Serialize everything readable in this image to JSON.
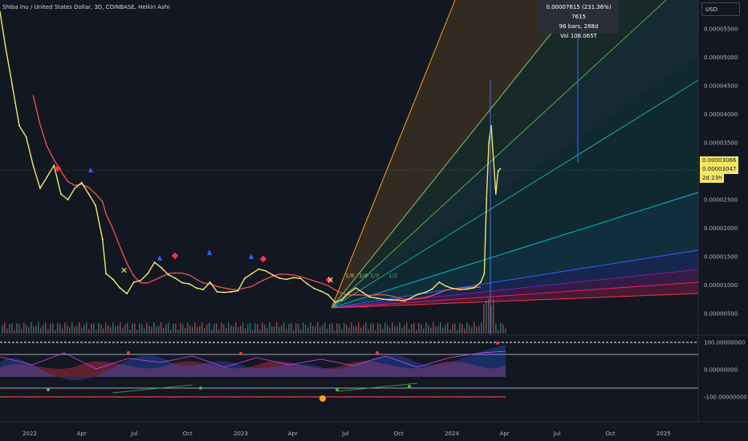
{
  "header": {
    "title": "Shiba Inu / United States Dollar, 3D, COINBASE, Heikin Ashi",
    "currency": "USD"
  },
  "measure_tooltip": {
    "line1": "0.00007615 (231.36%) 7615",
    "line2": "96 bars, 288d",
    "line3": "Vol 108.065T"
  },
  "price_tags": {
    "last": "0.00003066",
    "close": "0.00003047",
    "countdown": "2d 23h"
  },
  "fib_labels": [
    "1/8",
    "1/4",
    "1/3",
    "1/2"
  ],
  "colors": {
    "background": "#131722",
    "price_line": "#f5e663",
    "ma_line": "#f05454",
    "up_marker": "#2962ff",
    "down_marker": "#f23645"
  },
  "oscillator_axis": {
    "ticks": [
      {
        "label": "100.00000000",
        "value": 100
      },
      {
        "label": "0.00000000",
        "value": 0
      },
      {
        "label": "-100.00000000",
        "value": -100
      }
    ]
  },
  "chart_data": {
    "type": "line",
    "title": "Shiba Inu / United States Dollar, 3D, COINBASE, Heikin Ashi",
    "xlabel": "",
    "ylabel": "",
    "x_ticks": [
      "2022",
      "Apr",
      "Jul",
      "Oct",
      "2023",
      "Apr",
      "Jul",
      "Oct",
      "2024",
      "Apr",
      "Jul",
      "Oct",
      "2025"
    ],
    "y_ticks": [
      "0.00005500",
      "0.00005000",
      "0.00004500",
      "0.00004000",
      "0.00003500",
      "0.00003000",
      "0.00002500",
      "0.00002000",
      "0.00001500",
      "0.00001000",
      "0.00000500"
    ],
    "ylim": [
      3.5e-06,
      5.9e-05
    ],
    "grid": false,
    "series": [
      {
        "x": [
          "2021-11-08",
          "2021-11-20",
          "2021-12-02",
          "2021-12-14",
          "2021-12-26",
          "2022-01-07",
          "2022-01-19",
          "2022-01-31",
          "2022-02-12",
          "2022-02-24",
          "2022-03-08",
          "2022-03-20",
          "2022-04-01",
          "2022-04-13",
          "2022-04-25",
          "2022-05-07",
          "2022-05-13",
          "2022-05-25",
          "2022-06-06",
          "2022-06-18",
          "2022-06-30",
          "2022-07-12",
          "2022-07-24",
          "2022-08-05",
          "2022-08-17",
          "2022-08-29",
          "2022-09-10",
          "2022-09-22",
          "2022-10-04",
          "2022-10-16",
          "2022-10-28",
          "2022-11-09",
          "2022-11-21",
          "2022-12-03",
          "2022-12-15",
          "2022-12-27",
          "2023-01-08",
          "2023-01-20",
          "2023-02-01",
          "2023-02-13",
          "2023-02-25",
          "2023-03-09",
          "2023-03-21",
          "2023-04-02",
          "2023-04-14",
          "2023-04-26",
          "2023-05-08",
          "2023-05-20",
          "2023-06-01",
          "2023-06-13",
          "2023-06-25",
          "2023-07-07",
          "2023-07-19",
          "2023-07-31",
          "2023-08-12",
          "2023-08-24",
          "2023-09-05",
          "2023-09-17",
          "2023-09-29",
          "2023-10-11",
          "2023-10-23",
          "2023-11-04",
          "2023-11-16",
          "2023-11-28",
          "2023-12-10",
          "2023-12-22",
          "2024-01-03",
          "2024-01-15",
          "2024-01-27",
          "2024-02-08",
          "2024-02-20",
          "2024-02-26",
          "2024-03-01",
          "2024-03-05",
          "2024-03-09",
          "2024-03-13",
          "2024-03-17",
          "2024-03-21",
          "2024-03-25"
        ],
        "values": [
          5.8e-05,
          5.2e-05,
          4.5e-05,
          3.8e-05,
          3.6e-05,
          3.1e-05,
          2.7e-05,
          2.9e-05,
          3.1e-05,
          2.6e-05,
          2.5e-05,
          2.7e-05,
          2.8e-05,
          2.6e-05,
          2.4e-05,
          1.8e-05,
          1.2e-05,
          1.1e-05,
          9.5e-06,
          8.5e-06,
          1.05e-05,
          1.08e-05,
          1.2e-05,
          1.4e-05,
          1.3e-05,
          1.18e-05,
          1.12e-05,
          1.04e-05,
          1.02e-05,
          9.5e-06,
          9.2e-06,
          1.05e-05,
          8.8e-06,
          8.7e-06,
          8.8e-06,
          9e-06,
          1.12e-05,
          1.2e-05,
          1.28e-05,
          1.25e-05,
          1.18e-05,
          1.12e-05,
          1.1e-05,
          1.13e-05,
          1.12e-05,
          1.02e-05,
          9.4e-06,
          8.9e-06,
          8.3e-06,
          7e-06,
          7.4e-06,
          8.6e-06,
          9.5e-06,
          8.7e-06,
          7.9e-06,
          7.7e-06,
          7.5e-06,
          7.4e-06,
          7.4e-06,
          7.2e-06,
          7.8e-06,
          8.4e-06,
          8.7e-06,
          9.3e-06,
          1.05e-05,
          9.8e-06,
          9.4e-06,
          9.2e-06,
          9.3e-06,
          9.5e-06,
          1.05e-05,
          1.2e-05,
          2.5e-05,
          3.5e-05,
          3.8e-05,
          3.2e-05,
          2.6e-05,
          3e-05,
          3.047e-05
        ]
      }
    ]
  }
}
